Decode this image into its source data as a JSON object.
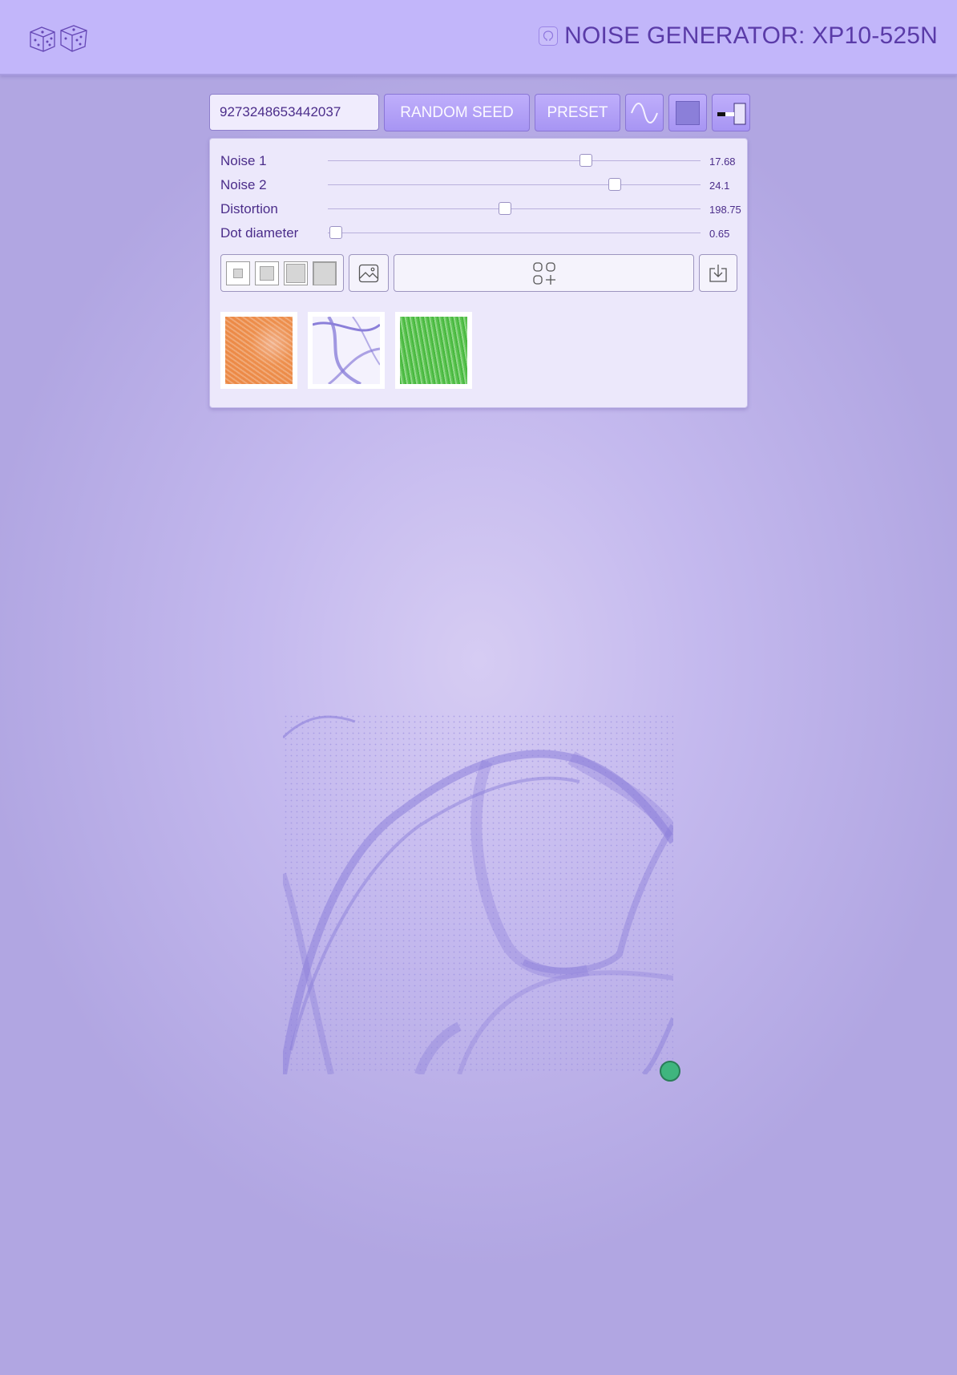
{
  "header": {
    "title": "NOISE GENERATOR: XP10-525N",
    "logo_icon": "dice-icon",
    "github_icon": "github-icon"
  },
  "toolbar": {
    "seed_value": "9273248653442037",
    "random_seed_label": "RANDOM SEED",
    "preset_label": "PRESET",
    "wave_icon": "sine-wave-icon",
    "color_icon": "color-swatch-icon",
    "toggle_icon": "contrast-toggle-icon"
  },
  "sliders": [
    {
      "label": "Noise 1",
      "value": "17.68",
      "fraction": 0.71
    },
    {
      "label": "Noise 2",
      "value": "24.1",
      "fraction": 0.79
    },
    {
      "label": "Distortion",
      "value": "198.75",
      "fraction": 0.49
    },
    {
      "label": "Dot diameter",
      "value": "0.65",
      "fraction": 0.01
    }
  ],
  "controls": {
    "size_options": [
      "size-small-icon",
      "size-medium-icon",
      "size-large-icon",
      "size-xlarge-icon"
    ],
    "image_icon": "image-icon",
    "add_grid_icon": "add-grid-icon",
    "download_icon": "download-icon"
  },
  "presets": [
    {
      "name": "preset-orange",
      "color": "#ec8a47"
    },
    {
      "name": "preset-purple",
      "color": "#8b7fd9"
    },
    {
      "name": "preset-green",
      "color": "#47b83e"
    }
  ],
  "colors": {
    "accent": "#a795f3",
    "header_bg": "#c2b6fa",
    "handle": "#3fb57e"
  }
}
